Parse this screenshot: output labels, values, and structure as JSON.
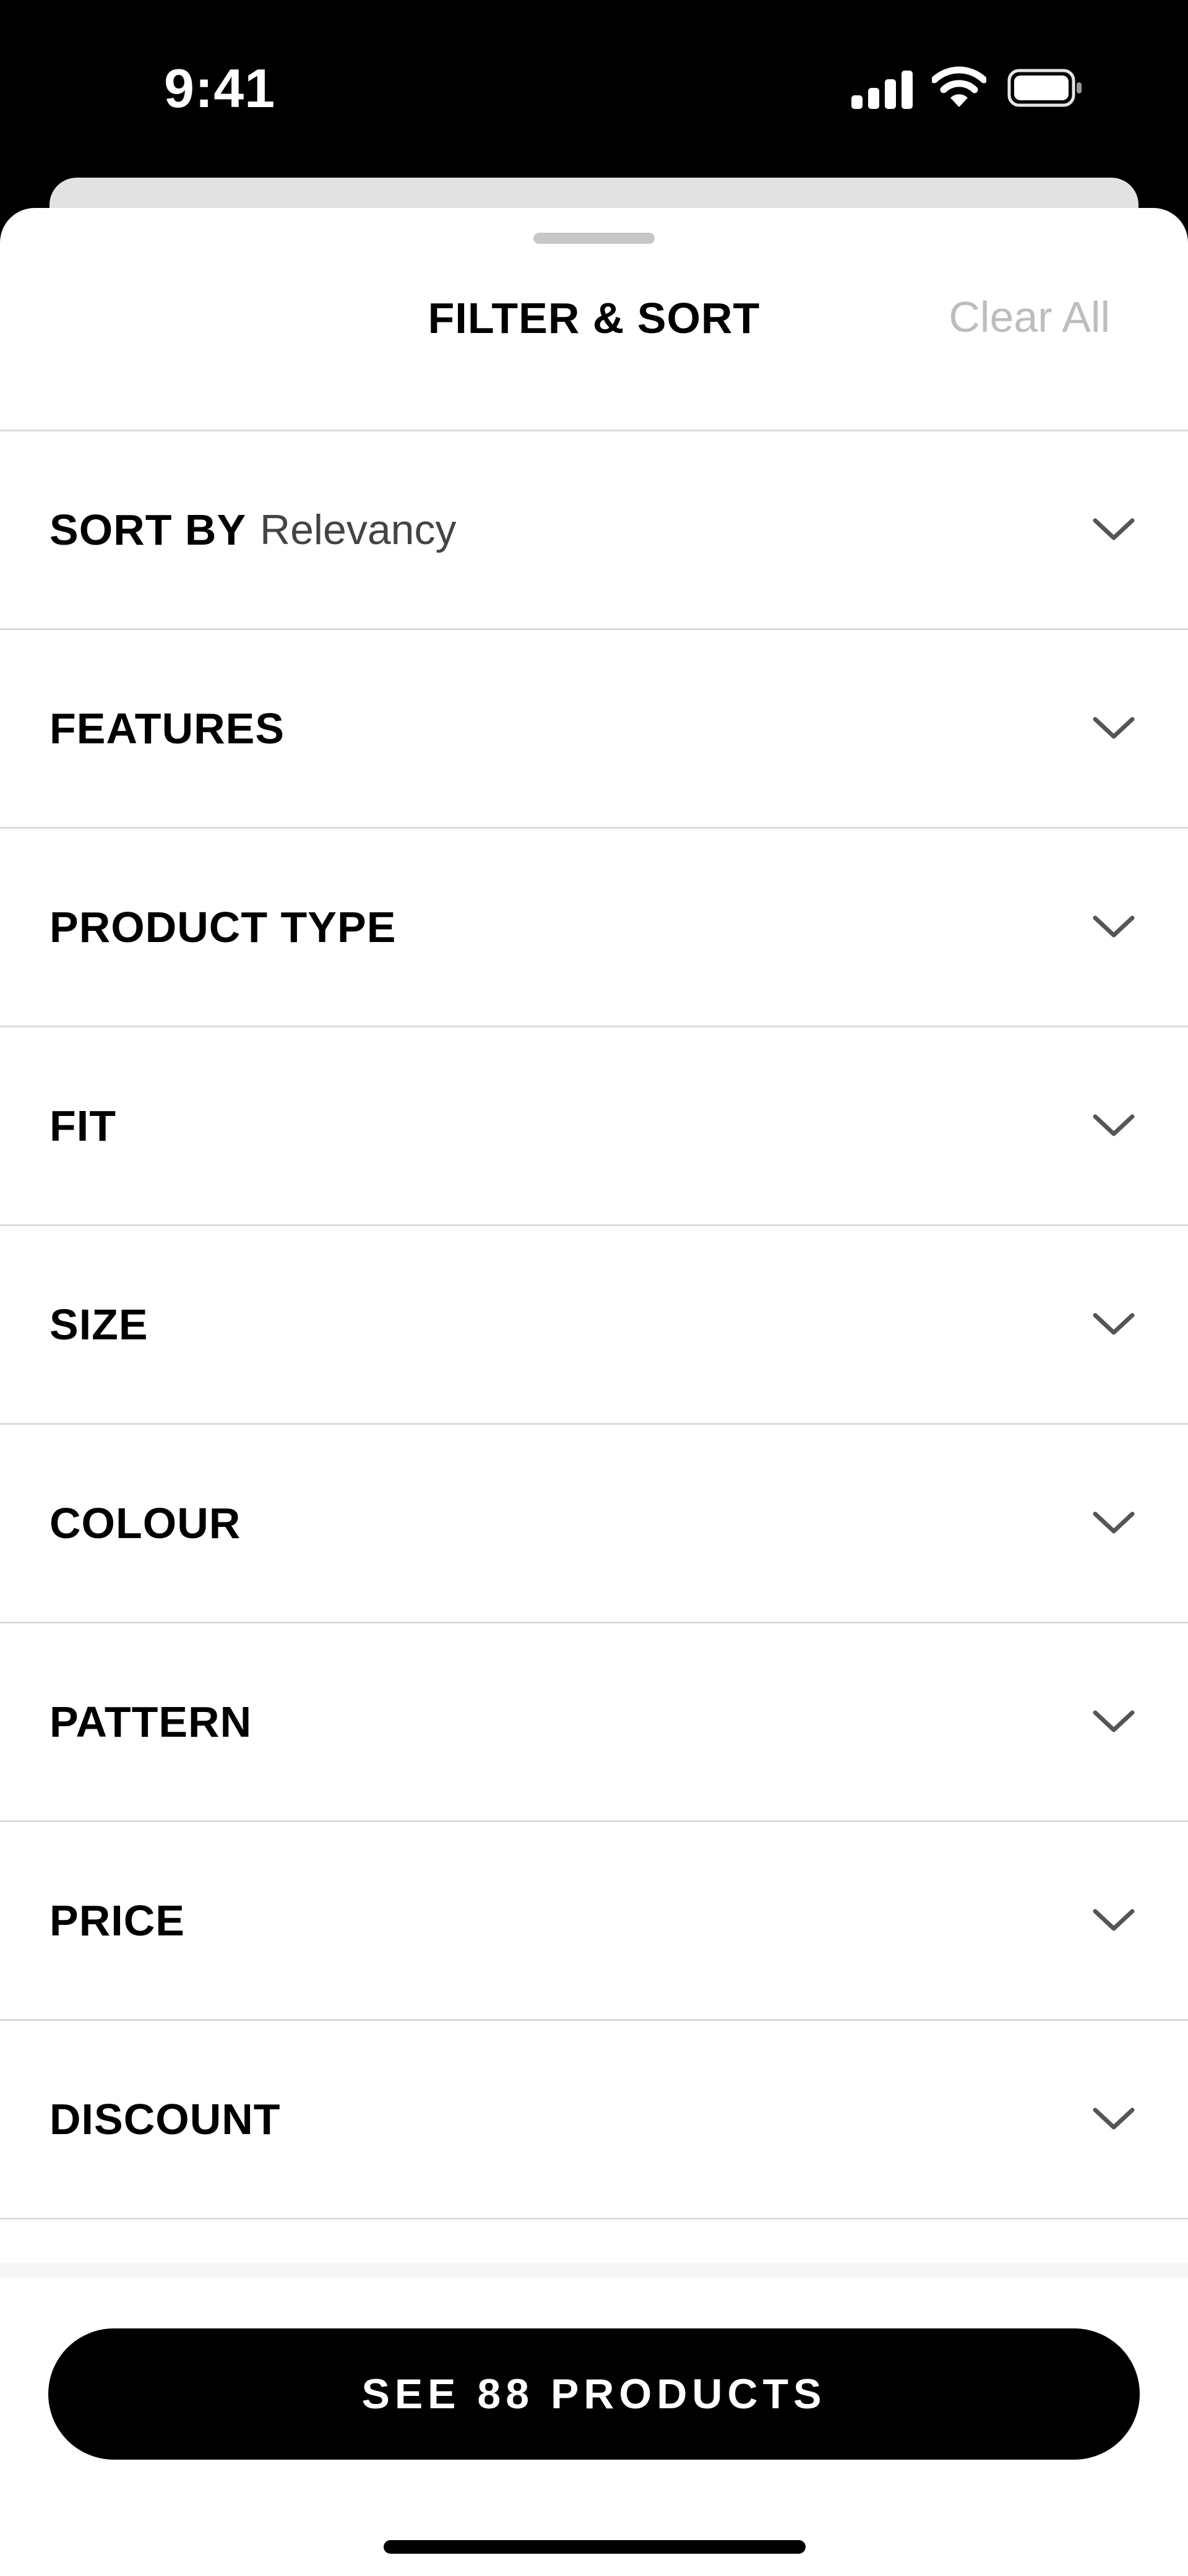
{
  "status_bar": {
    "time": "9:41"
  },
  "header": {
    "title": "FILTER & SORT",
    "clear_label": "Clear All"
  },
  "filters": [
    {
      "label": "SORT BY",
      "value": "Relevancy"
    },
    {
      "label": "FEATURES"
    },
    {
      "label": "PRODUCT TYPE"
    },
    {
      "label": "FIT"
    },
    {
      "label": "SIZE"
    },
    {
      "label": "COLOUR"
    },
    {
      "label": "PATTERN"
    },
    {
      "label": "PRICE"
    },
    {
      "label": "DISCOUNT"
    }
  ],
  "footer": {
    "cta_label": "SEE 88 PRODUCTS"
  },
  "icons": {
    "row_chevron": "chevron-down-icon",
    "signal": "cellular-signal-icon",
    "wifi": "wifi-icon",
    "battery": "battery-icon"
  },
  "colors": {
    "background": "#000000",
    "sheet": "#ffffff",
    "accent": "#000000",
    "muted_text": "#bdbdbd"
  }
}
